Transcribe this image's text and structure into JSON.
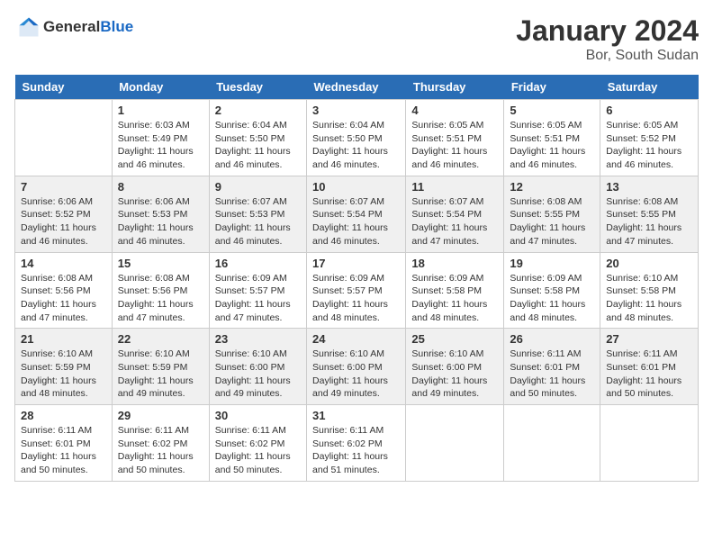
{
  "logo": {
    "general": "General",
    "blue": "Blue"
  },
  "header": {
    "month": "January 2024",
    "location": "Bor, South Sudan"
  },
  "weekdays": [
    "Sunday",
    "Monday",
    "Tuesday",
    "Wednesday",
    "Thursday",
    "Friday",
    "Saturday"
  ],
  "weeks": [
    [
      {
        "day": "",
        "sunrise": "",
        "sunset": "",
        "daylight": ""
      },
      {
        "day": "1",
        "sunrise": "Sunrise: 6:03 AM",
        "sunset": "Sunset: 5:49 PM",
        "daylight": "Daylight: 11 hours and 46 minutes."
      },
      {
        "day": "2",
        "sunrise": "Sunrise: 6:04 AM",
        "sunset": "Sunset: 5:50 PM",
        "daylight": "Daylight: 11 hours and 46 minutes."
      },
      {
        "day": "3",
        "sunrise": "Sunrise: 6:04 AM",
        "sunset": "Sunset: 5:50 PM",
        "daylight": "Daylight: 11 hours and 46 minutes."
      },
      {
        "day": "4",
        "sunrise": "Sunrise: 6:05 AM",
        "sunset": "Sunset: 5:51 PM",
        "daylight": "Daylight: 11 hours and 46 minutes."
      },
      {
        "day": "5",
        "sunrise": "Sunrise: 6:05 AM",
        "sunset": "Sunset: 5:51 PM",
        "daylight": "Daylight: 11 hours and 46 minutes."
      },
      {
        "day": "6",
        "sunrise": "Sunrise: 6:05 AM",
        "sunset": "Sunset: 5:52 PM",
        "daylight": "Daylight: 11 hours and 46 minutes."
      }
    ],
    [
      {
        "day": "7",
        "sunrise": "Sunrise: 6:06 AM",
        "sunset": "Sunset: 5:52 PM",
        "daylight": "Daylight: 11 hours and 46 minutes."
      },
      {
        "day": "8",
        "sunrise": "Sunrise: 6:06 AM",
        "sunset": "Sunset: 5:53 PM",
        "daylight": "Daylight: 11 hours and 46 minutes."
      },
      {
        "day": "9",
        "sunrise": "Sunrise: 6:07 AM",
        "sunset": "Sunset: 5:53 PM",
        "daylight": "Daylight: 11 hours and 46 minutes."
      },
      {
        "day": "10",
        "sunrise": "Sunrise: 6:07 AM",
        "sunset": "Sunset: 5:54 PM",
        "daylight": "Daylight: 11 hours and 46 minutes."
      },
      {
        "day": "11",
        "sunrise": "Sunrise: 6:07 AM",
        "sunset": "Sunset: 5:54 PM",
        "daylight": "Daylight: 11 hours and 47 minutes."
      },
      {
        "day": "12",
        "sunrise": "Sunrise: 6:08 AM",
        "sunset": "Sunset: 5:55 PM",
        "daylight": "Daylight: 11 hours and 47 minutes."
      },
      {
        "day": "13",
        "sunrise": "Sunrise: 6:08 AM",
        "sunset": "Sunset: 5:55 PM",
        "daylight": "Daylight: 11 hours and 47 minutes."
      }
    ],
    [
      {
        "day": "14",
        "sunrise": "Sunrise: 6:08 AM",
        "sunset": "Sunset: 5:56 PM",
        "daylight": "Daylight: 11 hours and 47 minutes."
      },
      {
        "day": "15",
        "sunrise": "Sunrise: 6:08 AM",
        "sunset": "Sunset: 5:56 PM",
        "daylight": "Daylight: 11 hours and 47 minutes."
      },
      {
        "day": "16",
        "sunrise": "Sunrise: 6:09 AM",
        "sunset": "Sunset: 5:57 PM",
        "daylight": "Daylight: 11 hours and 47 minutes."
      },
      {
        "day": "17",
        "sunrise": "Sunrise: 6:09 AM",
        "sunset": "Sunset: 5:57 PM",
        "daylight": "Daylight: 11 hours and 48 minutes."
      },
      {
        "day": "18",
        "sunrise": "Sunrise: 6:09 AM",
        "sunset": "Sunset: 5:58 PM",
        "daylight": "Daylight: 11 hours and 48 minutes."
      },
      {
        "day": "19",
        "sunrise": "Sunrise: 6:09 AM",
        "sunset": "Sunset: 5:58 PM",
        "daylight": "Daylight: 11 hours and 48 minutes."
      },
      {
        "day": "20",
        "sunrise": "Sunrise: 6:10 AM",
        "sunset": "Sunset: 5:58 PM",
        "daylight": "Daylight: 11 hours and 48 minutes."
      }
    ],
    [
      {
        "day": "21",
        "sunrise": "Sunrise: 6:10 AM",
        "sunset": "Sunset: 5:59 PM",
        "daylight": "Daylight: 11 hours and 48 minutes."
      },
      {
        "day": "22",
        "sunrise": "Sunrise: 6:10 AM",
        "sunset": "Sunset: 5:59 PM",
        "daylight": "Daylight: 11 hours and 49 minutes."
      },
      {
        "day": "23",
        "sunrise": "Sunrise: 6:10 AM",
        "sunset": "Sunset: 6:00 PM",
        "daylight": "Daylight: 11 hours and 49 minutes."
      },
      {
        "day": "24",
        "sunrise": "Sunrise: 6:10 AM",
        "sunset": "Sunset: 6:00 PM",
        "daylight": "Daylight: 11 hours and 49 minutes."
      },
      {
        "day": "25",
        "sunrise": "Sunrise: 6:10 AM",
        "sunset": "Sunset: 6:00 PM",
        "daylight": "Daylight: 11 hours and 49 minutes."
      },
      {
        "day": "26",
        "sunrise": "Sunrise: 6:11 AM",
        "sunset": "Sunset: 6:01 PM",
        "daylight": "Daylight: 11 hours and 50 minutes."
      },
      {
        "day": "27",
        "sunrise": "Sunrise: 6:11 AM",
        "sunset": "Sunset: 6:01 PM",
        "daylight": "Daylight: 11 hours and 50 minutes."
      }
    ],
    [
      {
        "day": "28",
        "sunrise": "Sunrise: 6:11 AM",
        "sunset": "Sunset: 6:01 PM",
        "daylight": "Daylight: 11 hours and 50 minutes."
      },
      {
        "day": "29",
        "sunrise": "Sunrise: 6:11 AM",
        "sunset": "Sunset: 6:02 PM",
        "daylight": "Daylight: 11 hours and 50 minutes."
      },
      {
        "day": "30",
        "sunrise": "Sunrise: 6:11 AM",
        "sunset": "Sunset: 6:02 PM",
        "daylight": "Daylight: 11 hours and 50 minutes."
      },
      {
        "day": "31",
        "sunrise": "Sunrise: 6:11 AM",
        "sunset": "Sunset: 6:02 PM",
        "daylight": "Daylight: 11 hours and 51 minutes."
      },
      {
        "day": "",
        "sunrise": "",
        "sunset": "",
        "daylight": ""
      },
      {
        "day": "",
        "sunrise": "",
        "sunset": "",
        "daylight": ""
      },
      {
        "day": "",
        "sunrise": "",
        "sunset": "",
        "daylight": ""
      }
    ]
  ]
}
